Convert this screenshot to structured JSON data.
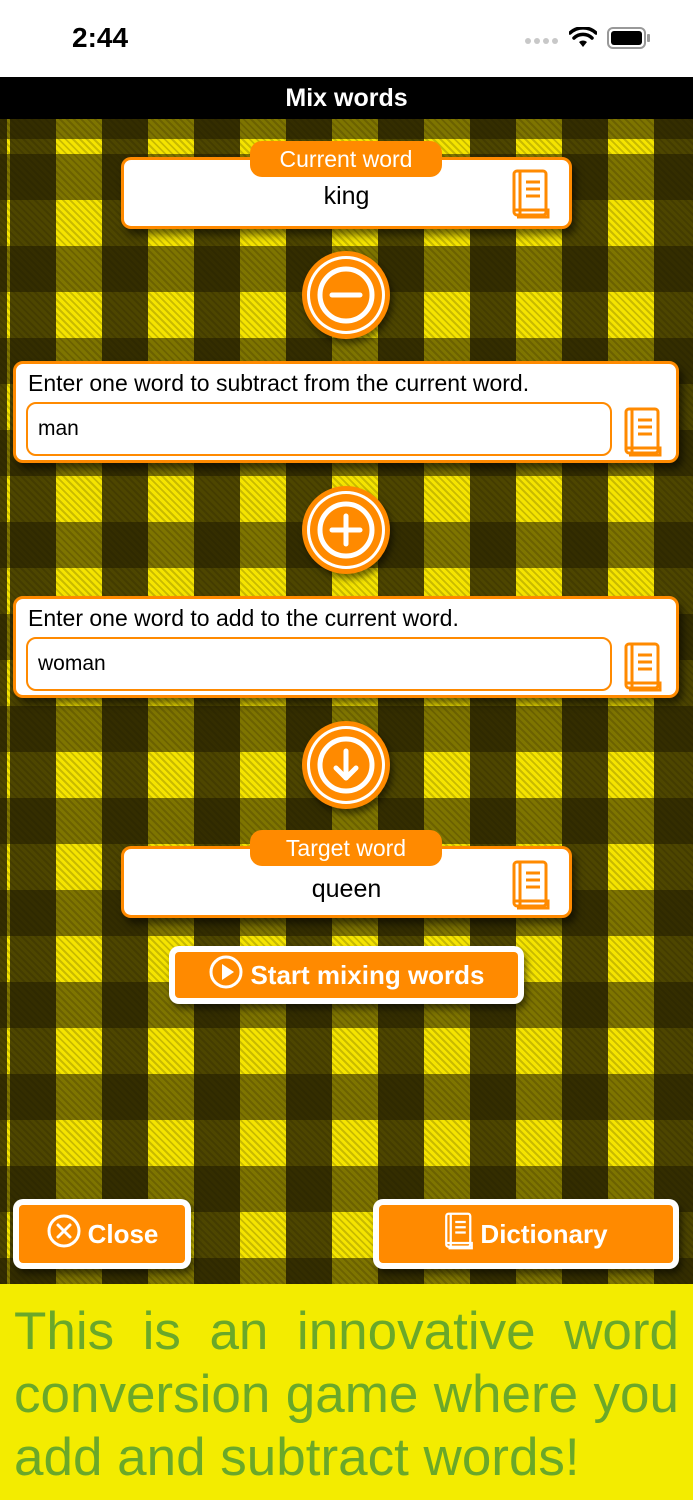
{
  "status_bar": {
    "time": "2:44"
  },
  "header": {
    "title": "Mix words"
  },
  "current_word": {
    "label": "Current word",
    "value": "king"
  },
  "subtract": {
    "prompt": "Enter one word to subtract from the current word.",
    "value": "man"
  },
  "add": {
    "prompt": "Enter one word to add to the current word.",
    "value": "woman"
  },
  "target_word": {
    "label": "Target word",
    "value": "queen"
  },
  "start_button": {
    "label": "Start mixing words"
  },
  "close_button": {
    "label": "Close"
  },
  "dictionary_button": {
    "label": "Dictionary"
  },
  "footer": {
    "text": "This is an innovative word conversion game where you add and subtract words!"
  },
  "colors": {
    "accent": "#ff8a00",
    "plaid_yellow": "#f5e400",
    "footer_bg": "#f3ec00",
    "footer_text": "#6aa829"
  },
  "icons": [
    "wifi-icon",
    "battery-icon",
    "cellular-icon",
    "book-icon",
    "minus-icon",
    "plus-icon",
    "arrow-down-icon",
    "play-icon",
    "close-circle-icon"
  ]
}
